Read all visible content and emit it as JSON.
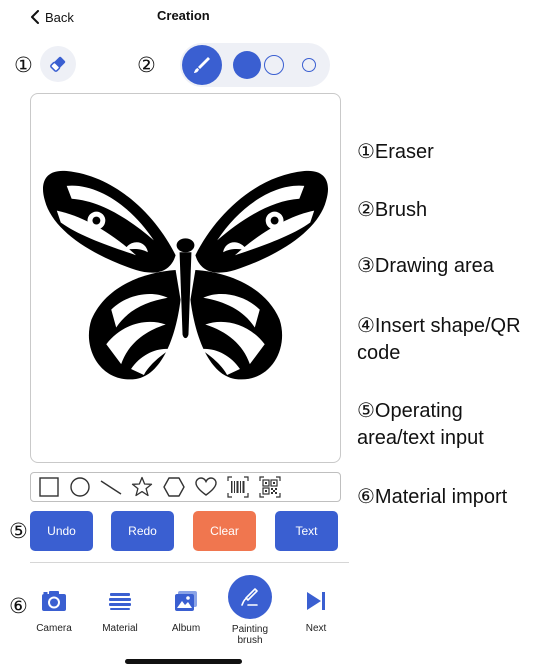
{
  "header": {
    "back_label": "Back",
    "title": "Creation"
  },
  "callouts": [
    "①",
    "②",
    "③",
    "④",
    "⑤",
    "⑥"
  ],
  "tools": {
    "eraser_icon": "eraser-icon",
    "brush_icon": "brush-icon",
    "sizes": [
      "large",
      "medium",
      "small"
    ],
    "selected_size": "large"
  },
  "canvas": {
    "image": "butterfly-drawing"
  },
  "shapes": [
    "square",
    "circle",
    "line",
    "star",
    "hexagon",
    "heart",
    "barcode",
    "qr-code"
  ],
  "operations": {
    "undo": "Undo",
    "redo": "Redo",
    "clear": "Clear",
    "text": "Text"
  },
  "bottom_bar": {
    "camera": "Camera",
    "material": "Material",
    "album": "Album",
    "painting_brush": "Painting\nbrush",
    "next": "Next"
  },
  "legend": {
    "l1": "①Eraser",
    "l2": "②Brush",
    "l3": "③Drawing area",
    "l4a": "④Insert shape/QR",
    "l4b": "code",
    "l5a": "⑤Operating",
    "l5b": "area/text input",
    "l6": "⑥Material import"
  },
  "colors": {
    "accent": "#3a5fd1",
    "clear": "#f0764f",
    "pill": "#eef0f6"
  }
}
